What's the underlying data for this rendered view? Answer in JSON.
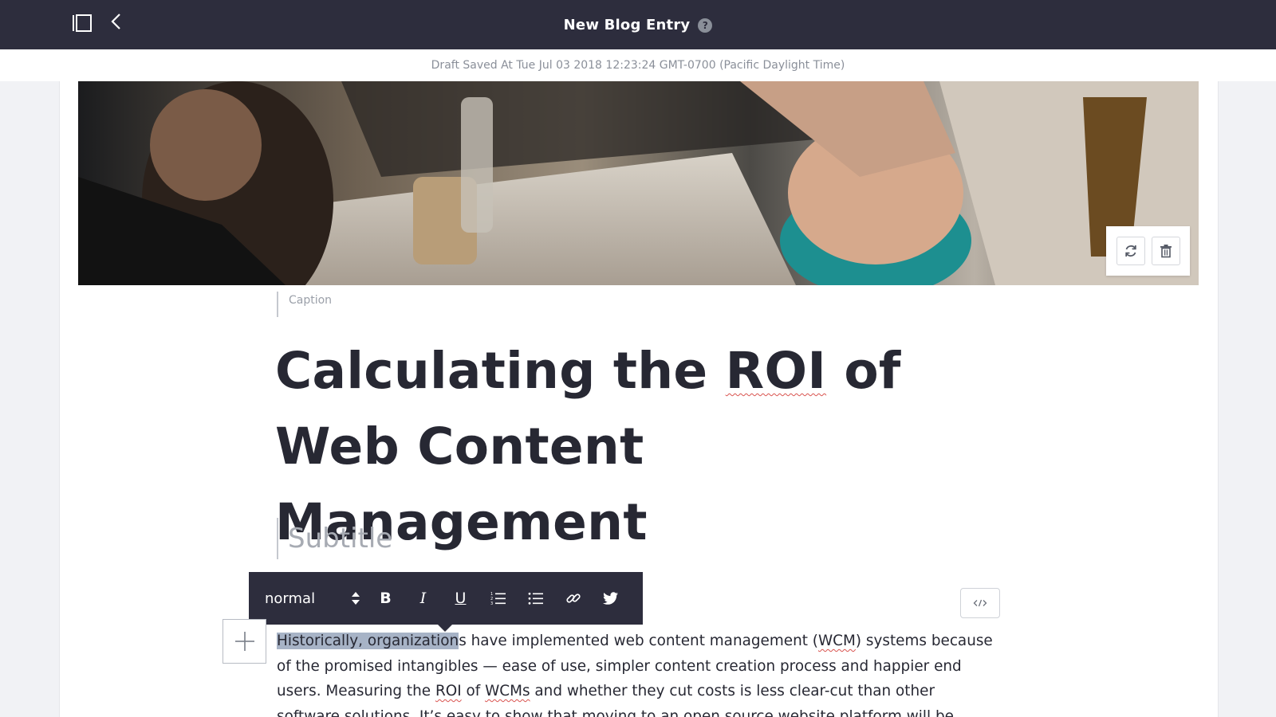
{
  "header": {
    "title": "New Blog Entry",
    "help_icon": "question-circle-icon",
    "help_glyph": "?"
  },
  "status": {
    "draft_saved": "Draft Saved At Tue Jul 03 2018 12:23:24 GMT-0700 (Pacific Daylight Time)"
  },
  "cover": {
    "caption_placeholder": "Caption"
  },
  "post": {
    "title_pre": "Calculating the ",
    "title_roi": "ROI",
    "title_post": " of",
    "title_line2": "Web Content Management",
    "subtitle_placeholder": "Subtitle"
  },
  "toolbar": {
    "style_value": "normal",
    "bold": "B",
    "italic": "I",
    "underline": "U"
  },
  "body": {
    "selected": "Historically, organization",
    "p1": "s have implemented web content management (",
    "wcm": "WCM",
    "p2": ") systems because of the promised intangibles — ease of use, simpler content creation process and happier end users. Measuring the ",
    "roi": "ROI",
    "p3": " of ",
    "wcms": "WCMs",
    "p4": " and whether they cut costs is less clear-cut than other software solutions. It’s easy to show that moving to an open source website platform will be cheaper than staying on a proprietary"
  },
  "colors": {
    "header_bg": "#2d2d3d",
    "selection": "#a7b3c6",
    "text": "#272833"
  }
}
